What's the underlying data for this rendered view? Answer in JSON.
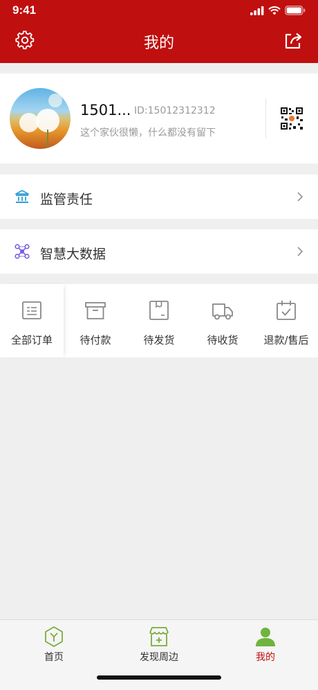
{
  "status_bar": {
    "time": "9:41"
  },
  "header": {
    "title": "我的"
  },
  "profile": {
    "username": "1501...",
    "user_id": "ID:15012312312",
    "bio": "这个家伙很懒，什么都没有留下"
  },
  "menu": [
    {
      "label": "监管责任",
      "icon": "bank-icon"
    },
    {
      "label": "智慧大数据",
      "icon": "network-icon"
    }
  ],
  "orders": [
    {
      "label": "全部订单",
      "icon": "order-list-icon"
    },
    {
      "label": "待付款",
      "icon": "box-icon"
    },
    {
      "label": "待发货",
      "icon": "package-icon"
    },
    {
      "label": "待收货",
      "icon": "truck-icon"
    },
    {
      "label": "退款/售后",
      "icon": "calendar-check-icon"
    }
  ],
  "tabbar": [
    {
      "label": "首页",
      "icon": "home-hexagon-icon"
    },
    {
      "label": "发现周边",
      "icon": "store-icon"
    },
    {
      "label": "我的",
      "icon": "person-icon",
      "active": true
    }
  ],
  "colors": {
    "brand_red": "#c00f0f",
    "active_tab_label": "#c00f0f",
    "active_tab_icon": "#6fb43f",
    "inactive_tab_icon": "#7cab3c",
    "bank_icon": "#2e9fd6",
    "network_icon": "#7b5be0"
  }
}
